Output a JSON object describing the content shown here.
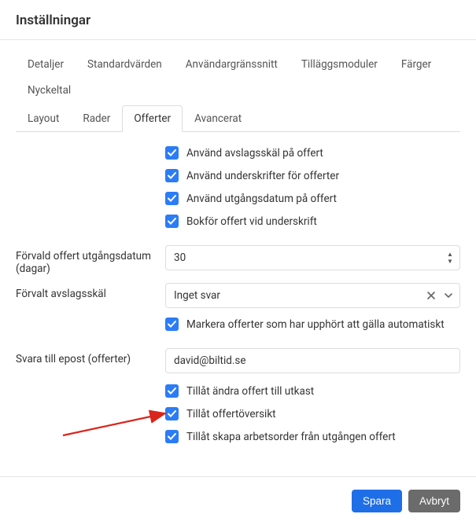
{
  "page_title": "Inställningar",
  "tabs_row1": {
    "detaljer": "Detaljer",
    "standardvarden": "Standardvärden",
    "anvandargranssnitt": "Användargränssnitt",
    "tillaggsmoduler": "Tilläggsmoduler",
    "farger": "Färger",
    "nyckeltal": "Nyckeltal"
  },
  "tabs_row2": {
    "layout": "Layout",
    "rader": "Rader",
    "offerter": "Offerter",
    "avancerat": "Avancerat"
  },
  "checks": {
    "avslagsskael": "Använd avslagsskäl på offert",
    "underskrifter": "Använd underskrifter för offerter",
    "utgangsdatum": "Använd utgångsdatum på offert",
    "bokfor": "Bokför offert vid underskrift",
    "markera_upphort": "Markera offerter som har upphört att gälla automatiskt",
    "tillat_andra": "Tillåt ändra offert till utkast",
    "tillat_oversikt": "Tillåt offertöversikt",
    "tillat_skapa": "Tillåt skapa arbetsorder från utgången offert"
  },
  "labels": {
    "forvald_utgang": "Förvald offert utgångsdatum (dagar)",
    "forvalt_avslag": "Förvalt avslagsskäl",
    "svara_epost": "Svara till epost (offerter)"
  },
  "values": {
    "dagar": "30",
    "avslag": "Inget svar",
    "epost": "david@biltid.se"
  },
  "buttons": {
    "save": "Spara",
    "cancel": "Avbryt"
  }
}
